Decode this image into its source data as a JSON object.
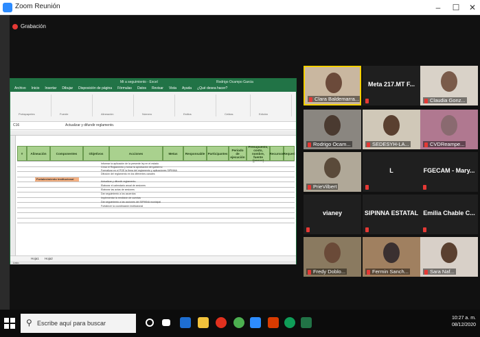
{
  "window": {
    "title": "Zoom Reunión",
    "minimize": "–",
    "maximize": "☐",
    "close": "✕"
  },
  "recording": {
    "label": "Grabación"
  },
  "excel": {
    "title": "Mt a seguimiento - Excel",
    "user": "Rodrigo Ocampo Garcia",
    "tabs": [
      "Archivo",
      "Inicio",
      "Insertar",
      "Dibujar",
      "Disposición de página",
      "Fórmulas",
      "Datos",
      "Revisar",
      "Vista",
      "Ayuda",
      "¿Qué desea hacer?"
    ],
    "share": "Compartir",
    "ribbon_groups": [
      "Portapapeles",
      "Fuente",
      "Alineación",
      "Número",
      "Estilos",
      "Celdas",
      "Edición"
    ],
    "cell_ref": "C16",
    "formula": "Actualizar y difundir reglamento.",
    "headers": [
      "#",
      "Alineación",
      "Componentes",
      "Objetivos",
      "Acciones",
      "Metas",
      "Responsable",
      "Participantes",
      "Periodo de ejecución",
      "Presupuesto, costo, nombre, fuente (pesos)",
      "Recursos",
      "Requeri"
    ],
    "component_label": "Fortalecimiento institucional",
    "actions": [
      "Informar la aplicación de la presente ley en el estado",
      "Crear el Reglamento y tomar la aprobación del gobierno",
      "Formalizar en el POE la firma del reglamento y aplicaciones SIPINNA",
      "Difusión del reglamento en los diferentes canales",
      "Actualizar y difundir reglamento.",
      "Elaborar el calendario anual de sesiones",
      "Elaborar las actas de sesiones",
      "Dar seguimiento a los acuerdos",
      "Implementar la rendición de cuentas",
      "Dar seguimiento a las acciones del SIPINNA municipal",
      "Fortalecer la coordinación institucional"
    ],
    "sheets": [
      "Hoja1",
      "Hoja2"
    ],
    "status": "Listo"
  },
  "participants": [
    {
      "name": "Clara Baldemarra...",
      "type": "video",
      "active": true
    },
    {
      "name": "Meta 217.MT F...",
      "type": "name"
    },
    {
      "name": "Claudia Gonz...",
      "type": "video"
    },
    {
      "name": "Rodrigo Ocam...",
      "type": "video"
    },
    {
      "name": "SEDESYH-LA...",
      "type": "video"
    },
    {
      "name": "CVDReampe...",
      "type": "video"
    },
    {
      "name": "PrieVilbert",
      "type": "video"
    },
    {
      "name": "L",
      "type": "name"
    },
    {
      "name": "FGECAM - Mary...",
      "type": "name"
    },
    {
      "name": "vianey",
      "type": "name"
    },
    {
      "name": "SIPINNA ESTATAL",
      "type": "name"
    },
    {
      "name": "Emilia Chable C...",
      "type": "name"
    },
    {
      "name": "Fredy Doblo...",
      "type": "video"
    },
    {
      "name": "Fermin Sanch...",
      "type": "video"
    },
    {
      "name": "Sara Naf...",
      "type": "video"
    }
  ],
  "taskbar": {
    "search_placeholder": "Escribe aquí para buscar",
    "time": "10:27 a. m.",
    "date": "08/12/2020"
  }
}
